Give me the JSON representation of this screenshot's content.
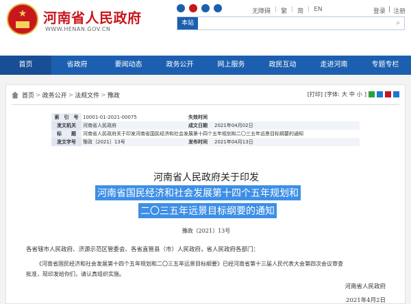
{
  "header": {
    "site_title": "河南省人民政府",
    "site_url": "WWW.HENAN.GOV.CN",
    "top_links": [
      "无障碍",
      "繁",
      "简",
      "EN"
    ],
    "login_links": [
      "登录",
      "注册"
    ],
    "search_scope": "本站",
    "search_placeholder": ""
  },
  "nav": [
    "首页",
    "省政府",
    "要闻动态",
    "政务公开",
    "网上服务",
    "政民互动",
    "走进河南",
    "专题专栏"
  ],
  "breadcrumb": [
    "首页",
    "政务公开",
    "法规文件",
    "豫政"
  ],
  "tools": {
    "print": "[打印]",
    "font_label": "[字体:",
    "big": "大",
    "mid": "中",
    "small": "小",
    "close": "]"
  },
  "meta": {
    "row1": {
      "k1": "索　引　号",
      "v1": "10001-01-2021-00075",
      "k2": "失效时间",
      "v2": ""
    },
    "row2": {
      "k1": "发文机关",
      "v1": "河南省人民政府",
      "k2": "成文日期",
      "v2": "2021年04月02日"
    },
    "row3": {
      "k1": "标　　题",
      "v1": "河南省人民政府关于印发河南省国民经济和社会发展第十四个五年规划和二〇三五年远景目标纲要的通知"
    },
    "row4": {
      "k1": "发文字号",
      "v1": "豫政〔2021〕13号",
      "k2": "发布时间",
      "v2": "2021年04月13日"
    }
  },
  "article": {
    "title_line1": "河南省人民政府关于印发",
    "title_line2": "河南省国民经济和社会发展第十四个五年规划和",
    "title_line3": "二〇三五年远景目标纲要的通知",
    "doc_no": "豫政〔2021〕13号",
    "salutation": "各省辖市人民政府、济源示范区管委会、各省直管县（市）人民政府，省人民政府各部门：",
    "para1": "《河南省国民经济和社会发展第十四个五年规划和二〇三五年远景目标纲要》已经河南省第十三届人民代表大会第四次会议审查",
    "para1_cont": "批准，现印发给你们，请认真组织实施。",
    "signer": "河南省人民政府",
    "date": "2021年4月2日"
  }
}
